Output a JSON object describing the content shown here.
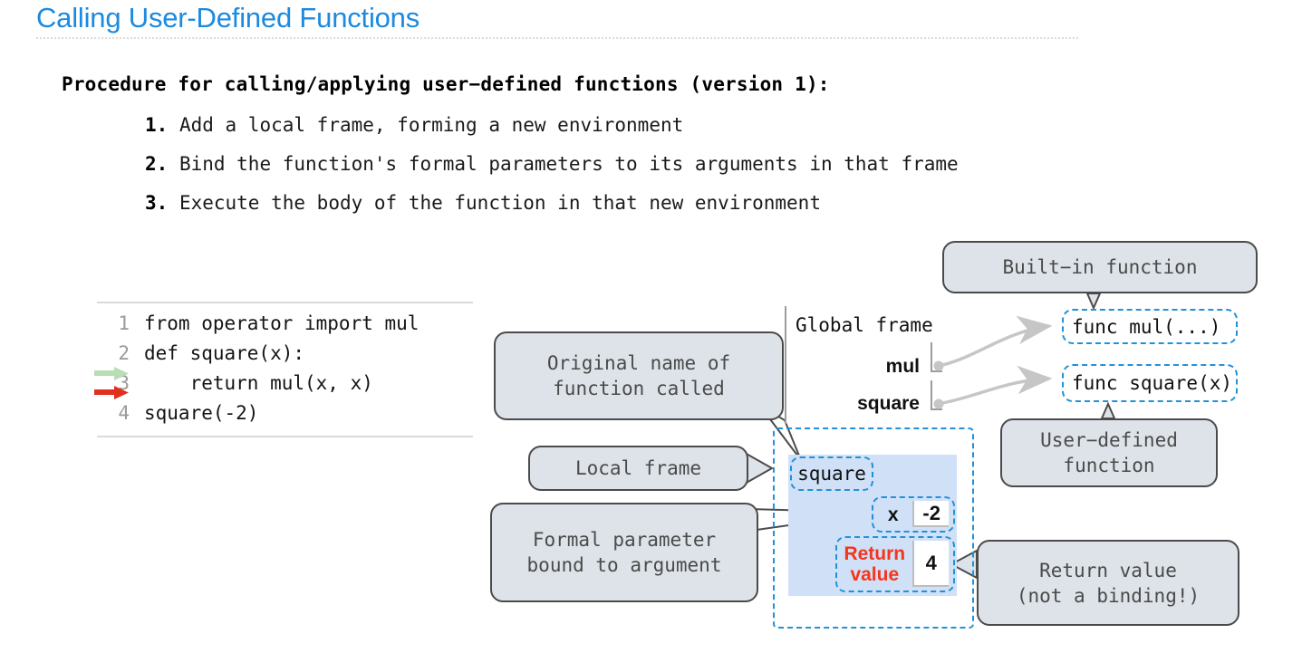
{
  "slide": {
    "title": "Calling User-Defined Functions"
  },
  "procedure": {
    "heading": "Procedure for calling/applying user−defined functions (version 1):",
    "steps": [
      {
        "num": "1.",
        "text": "Add a local frame, forming a new environment"
      },
      {
        "num": "2.",
        "text": "Bind the function's formal parameters to its arguments in that frame"
      },
      {
        "num": "3.",
        "text": "Execute the body of the function in that new environment"
      }
    ]
  },
  "code": {
    "lines": [
      {
        "no": "1",
        "text": "from operator import mul",
        "marker": ""
      },
      {
        "no": "2",
        "text": "def square(x):",
        "marker": ""
      },
      {
        "no": "3",
        "text": "    return mul(x, x)",
        "marker": "green-arrow,red-arrow"
      },
      {
        "no": "4",
        "text": "square(-2)",
        "marker": ""
      }
    ],
    "marker_colors": {
      "green": "#b9ddb4",
      "red": "#e0301e"
    }
  },
  "diagram": {
    "global_frame": {
      "label": "Global frame",
      "bindings": [
        {
          "name": "mul",
          "target": "func-mul"
        },
        {
          "name": "square",
          "target": "func-square"
        }
      ]
    },
    "function_values": [
      {
        "id": "func-mul",
        "text": "func mul(...)"
      },
      {
        "id": "func-square",
        "text": "func square(x)"
      }
    ],
    "local_frame": {
      "name": "square",
      "bindings": [
        {
          "key": "x",
          "value": "-2",
          "key_color": "#111111"
        },
        {
          "key": "Return\nvalue",
          "value": "4",
          "key_color": "#f5351c"
        }
      ],
      "fill_color": "#cfe0f7",
      "border_color": "#2191d9"
    },
    "callouts": [
      {
        "id": "callout-builtin",
        "text": "Built−in function"
      },
      {
        "id": "callout-original",
        "text": "Original name of\nfunction called"
      },
      {
        "id": "callout-userdefined",
        "text": "User−defined\nfunction"
      },
      {
        "id": "callout-localframe",
        "text": "Local frame"
      },
      {
        "id": "callout-formalparam",
        "text": "Formal parameter\nbound to argument"
      },
      {
        "id": "callout-returnvalue",
        "text": "Return value\n(not a binding!)"
      }
    ]
  },
  "colors": {
    "title_blue": "#1b8ae0",
    "callout_fill": "#dde3e9",
    "callout_border": "#4b4b4b",
    "dashed_blue": "#2191d9",
    "frame_fill": "#cfe0f7",
    "return_red": "#f5351c",
    "arrow_gray": "#c6c6c6"
  }
}
